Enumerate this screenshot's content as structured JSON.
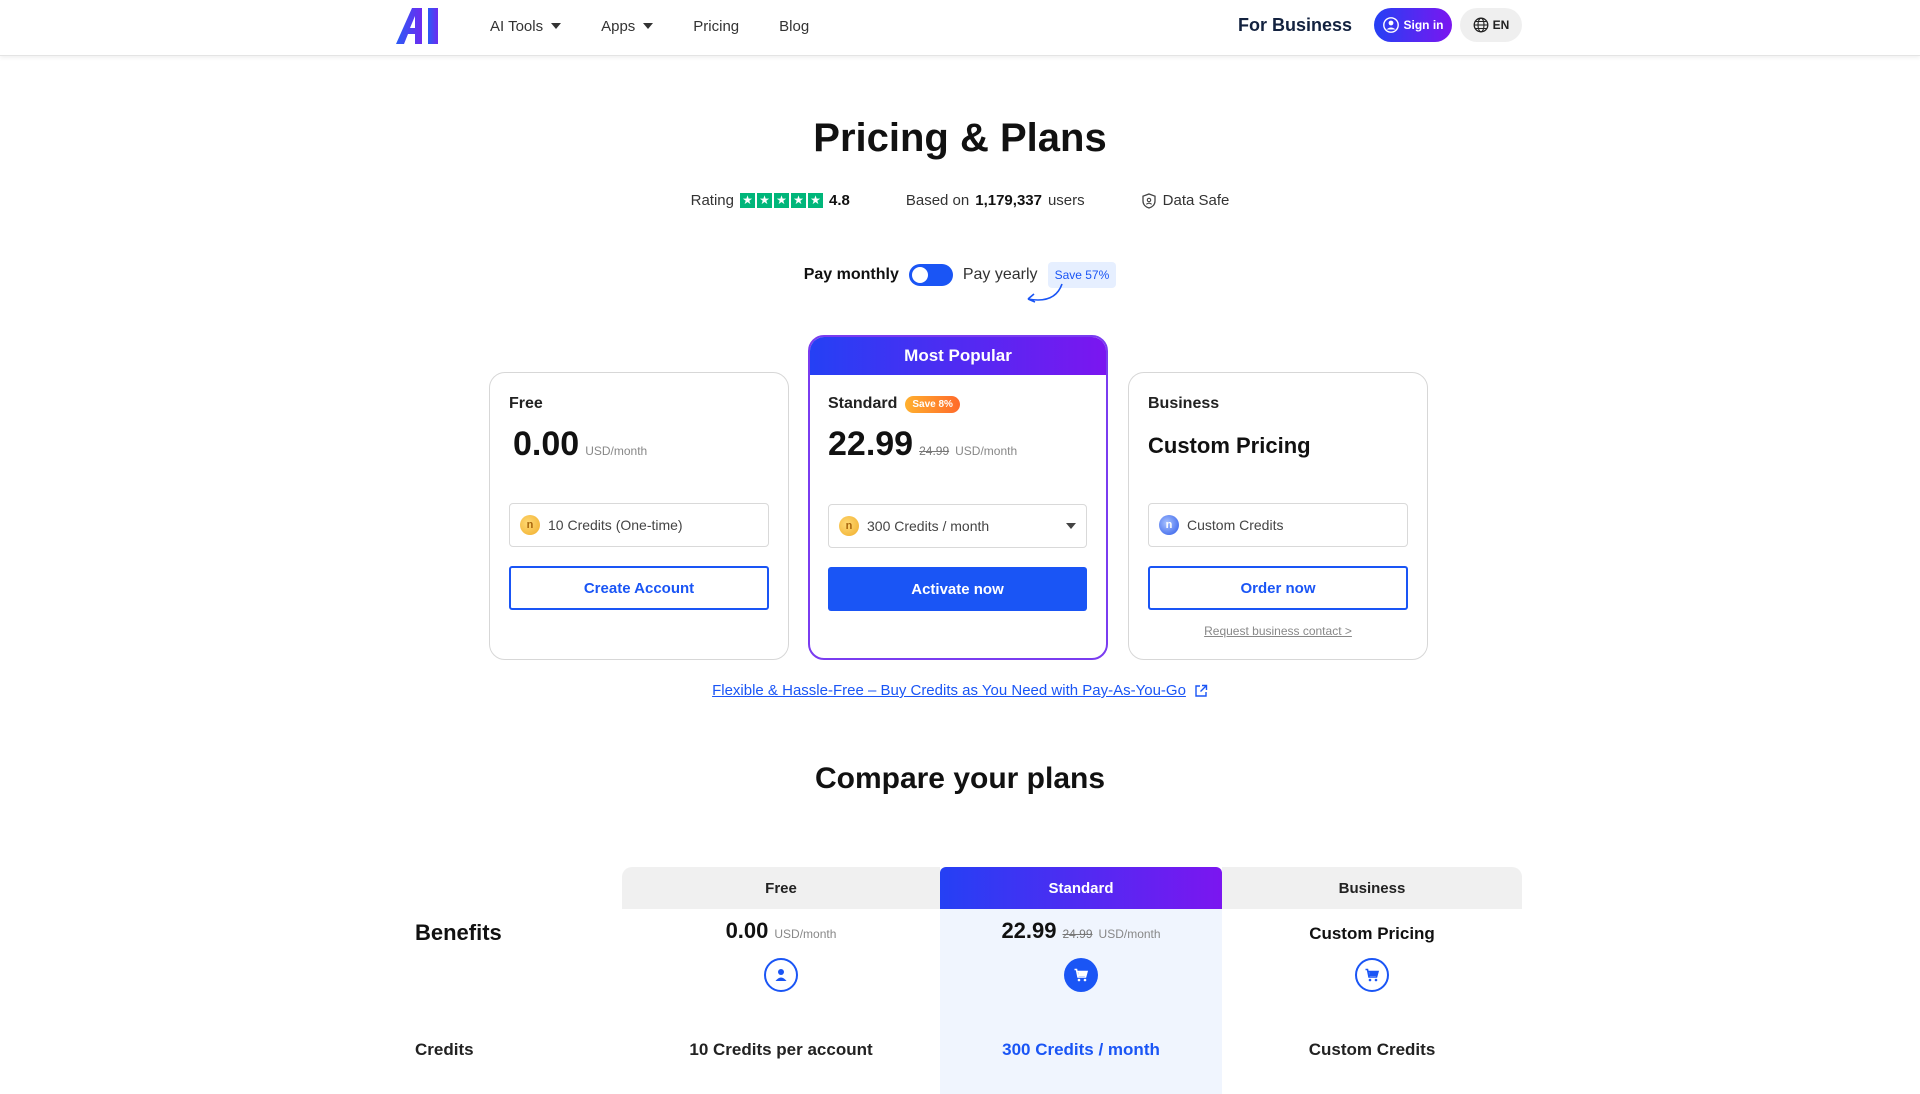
{
  "header": {
    "logo_text": "AI",
    "nav": [
      {
        "label": "AI Tools"
      },
      {
        "label": "Apps"
      },
      {
        "label": "Pricing"
      },
      {
        "label": "Blog"
      }
    ],
    "for_business": "For Business",
    "sign_in": "Sign in",
    "language": "EN"
  },
  "hero": {
    "title": "Pricing & Plans",
    "rating_label": "Rating",
    "rating_value": "4.8",
    "based_on_prefix": "Based on",
    "users_count": "1,179,337",
    "users_suffix": "users",
    "data_safe": "Data Safe"
  },
  "billing": {
    "monthly": "Pay monthly",
    "yearly": "Pay yearly",
    "save": "Save 57%"
  },
  "plans": {
    "free": {
      "name": "Free",
      "price": "0.00",
      "unit": "USD/month",
      "credits": "10 Credits (One-time)",
      "cta": "Create Account"
    },
    "standard": {
      "badge": "Most Popular",
      "name": "Standard",
      "save": "Save 8%",
      "price": "22.99",
      "old_price": "24.99",
      "unit": "USD/month",
      "credits": "300 Credits / month",
      "cta": "Activate now"
    },
    "business": {
      "name": "Business",
      "price": "Custom Pricing",
      "credits": "Custom Credits",
      "cta": "Order now",
      "contact": "Request business contact >"
    }
  },
  "payg_link": "Flexible & Hassle-Free – Buy Credits as You Need with Pay-As-You-Go",
  "compare": {
    "title": "Compare your plans",
    "benefits": "Benefits",
    "columns": {
      "free": {
        "name": "Free",
        "price": "0.00",
        "unit": "USD/month"
      },
      "standard": {
        "name": "Standard",
        "price": "22.99",
        "old_price": "24.99",
        "unit": "USD/month"
      },
      "business": {
        "name": "Business",
        "price": "Custom Pricing"
      }
    },
    "rows": [
      {
        "label": "Credits",
        "free": "10 Credits per account",
        "standard": "300 Credits / month",
        "business": "Custom Credits"
      }
    ]
  },
  "colors": {
    "accent": "#1a55f5",
    "gradient_start": "#2540f4",
    "gradient_end": "#7b16f0",
    "trustpilot_green": "#00b67a",
    "standard_column_bg": "#f0f5fe"
  },
  "icons": {
    "user": "user-icon",
    "cart": "cart-icon",
    "shield": "shield-icon",
    "globe": "globe-icon",
    "external": "external-link-icon"
  }
}
